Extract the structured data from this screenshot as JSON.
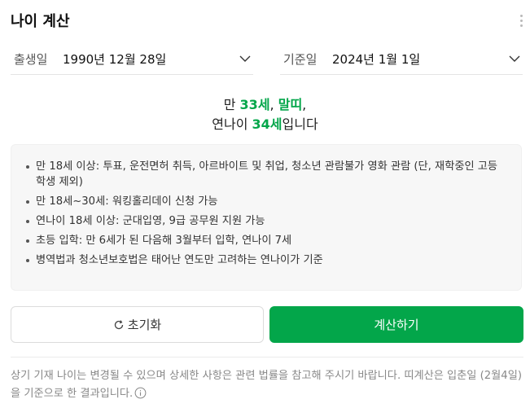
{
  "header": {
    "title": "나이 계산"
  },
  "birth": {
    "label": "출생일",
    "value": "1990년 12월 28일"
  },
  "base": {
    "label": "기준일",
    "value": "2024년 1월 1일"
  },
  "result": {
    "prefix": "만 ",
    "age": "33세",
    "comma1": ", ",
    "zodiac": "말띠",
    "comma2": ",",
    "korean_prefix": "연나이 ",
    "korean_age": "34세",
    "suffix": "입니다"
  },
  "info": {
    "items": [
      "만 18세 이상: 투표, 운전면허 취득, 아르바이트 및 취업, 청소년 관람불가 영화 관람 (단, 재학중인 고등학생 제외)",
      "만 18세~30세: 워킹홀리데이 신청 가능",
      "연나이 18세 이상: 군대입영, 9급 공무원 지원 가능",
      "초등 입학: 만 6세가 된 다음해 3월부터 입학, 연나이 7세",
      "병역법과 청소년보호법은 태어난 연도만 고려하는 연나이가 기준"
    ]
  },
  "buttons": {
    "reset": "초기화",
    "calculate": "계산하기"
  },
  "notice": {
    "text": "상기 기재 나이는 변경될 수 있으며 상세한 사항은 관련 법률을 참고해 주시기 바랍니다. 띠계산은 입춘일 (2월4일)을 기준으로 한 결과입니다."
  },
  "colors": {
    "accent": "#03a64a",
    "info_bg": "#f7f7f7"
  },
  "icons": {
    "more": "more-vertical-icon",
    "chevron": "chevron-down-icon",
    "reset": "refresh-icon",
    "notice": "info-circle-icon"
  }
}
